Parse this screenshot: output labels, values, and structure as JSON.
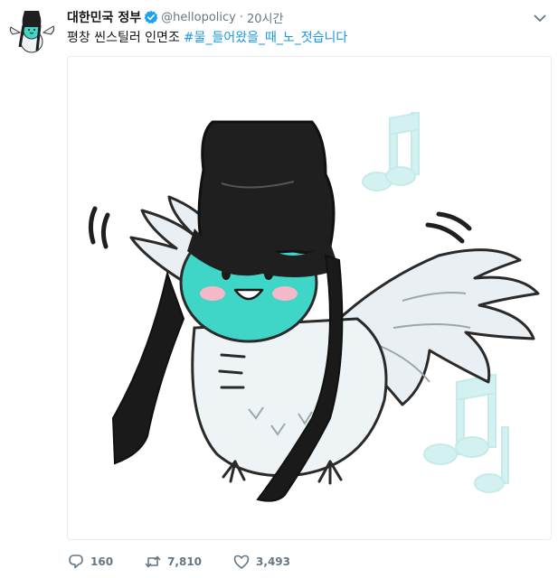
{
  "tweet": {
    "author": {
      "display_name": "대한민국 정부",
      "handle": "@hellopolicy",
      "verified": true
    },
    "time": "20시간",
    "dot": "·",
    "text": "평창 씬스틸러 인면조",
    "hashtag": "#물_들어왔을_때_노_젓습니다",
    "media": {
      "description_icon": "illustration"
    },
    "actions": {
      "reply_count": "160",
      "retweet_count": "7,810",
      "like_count": "3,493"
    }
  },
  "colors": {
    "link": "#1b95e0",
    "secondary_text": "#657786",
    "verified": "#1da1f2",
    "mascot_face": "#3fd6c8",
    "note": "#d3f1f0"
  },
  "icons": {
    "reply": "speech-bubble-icon",
    "retweet": "retweet-arrows-icon",
    "like": "heart-icon",
    "menu": "chevron-down-icon",
    "verified": "verified-badge-icon"
  }
}
